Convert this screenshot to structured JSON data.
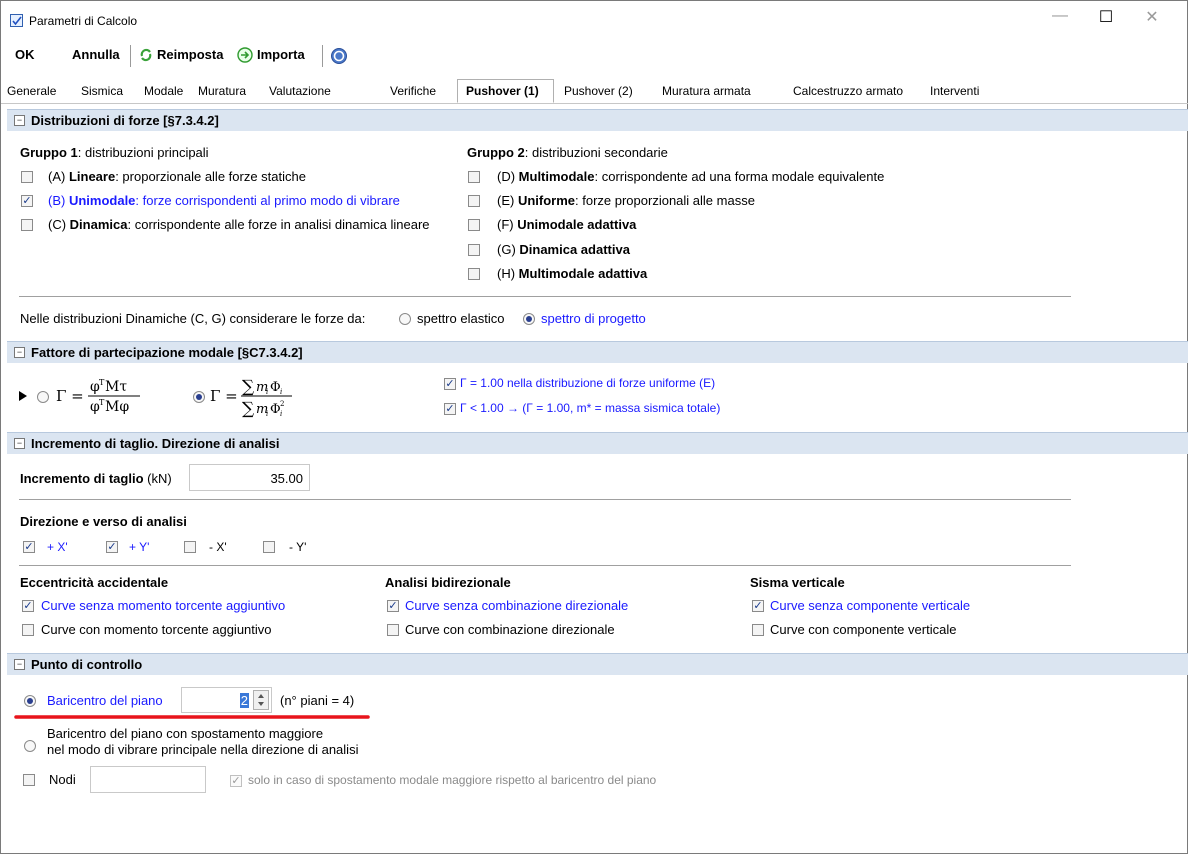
{
  "window": {
    "title": "Parametri di Calcolo",
    "minimize": "—",
    "maximize": "☐",
    "close": "✕"
  },
  "toolbar": {
    "ok": "OK",
    "annulla": "Annulla",
    "reimposta": "Reimposta",
    "importa": "Importa"
  },
  "tabs": [
    "Generale",
    "Sismica",
    "Modale",
    "Muratura",
    "Valutazione",
    "Verifiche",
    "Pushover (1)",
    "Pushover (2)",
    "Muratura armata",
    "Calcestruzzo armato",
    "Interventi"
  ],
  "active_tab": "Pushover (1)",
  "sec1": {
    "title": "Distribuzioni di forze [§7.3.4.2]",
    "g1_title_bold": "Gruppo 1",
    "g1_title_rest": ": distribuzioni principali",
    "g1": [
      {
        "prefix": "(A) ",
        "bold": "Lineare",
        "rest": ": proporzionale alle forze statiche",
        "checked": false
      },
      {
        "prefix": "(B) ",
        "bold": "Unimodale",
        "rest": ": forze corrispondenti al primo modo di vibrare",
        "checked": true
      },
      {
        "prefix": "(C) ",
        "bold": "Dinamica",
        "rest": ": corrispondente alle forze in analisi dinamica lineare",
        "checked": false
      }
    ],
    "g2_title_bold": "Gruppo 2",
    "g2_title_rest": ": distribuzioni secondarie",
    "g2": [
      {
        "prefix": "(D) ",
        "bold": "Multimodale",
        "rest": ": corrispondente ad una forma modale equivalente",
        "checked": false
      },
      {
        "prefix": "(E) ",
        "bold": "Uniforme",
        "rest": ": forze proporzionali alle masse",
        "checked": false
      },
      {
        "prefix": "(F) ",
        "bold": "Unimodale adattiva",
        "rest": "",
        "checked": false
      },
      {
        "prefix": "(G) ",
        "bold": "Dinamica adattiva",
        "rest": "",
        "checked": false
      },
      {
        "prefix": "(H) ",
        "bold": "Multimodale adattiva",
        "rest": "",
        "checked": false
      }
    ],
    "dyn_label": "Nelle distribuzioni Dinamiche (C, G) considerare le forze da:",
    "dyn_opt1": "spettro elastico",
    "dyn_opt2": "spettro di progetto"
  },
  "sec2": {
    "title": "Fattore di partecipazione modale [§C7.3.4.2]",
    "check1": "Γ = 1.00 nella distribuzione di forze uniforme (E)",
    "check2": "Γ < 1.00 → (Γ = 1.00, m* = massa sismica totale)"
  },
  "sec3": {
    "title": "Incremento di taglio. Direzione di analisi",
    "incr_label_bold": "Incremento di taglio",
    "incr_label_rest": " (kN)",
    "incr_value": "35.00",
    "dir_title": "Direzione e verso di analisi",
    "dirs": [
      {
        "label": "+ X'",
        "checked": true
      },
      {
        "label": "+ Y'",
        "checked": true
      },
      {
        "label": "- X'",
        "checked": false
      },
      {
        "label": "- Y'",
        "checked": false
      }
    ],
    "ecc_title": "Eccentricità accidentale",
    "ecc_opt1": "Curve senza momento torcente aggiuntivo",
    "ecc_opt2": "Curve con momento torcente aggiuntivo",
    "bid_title": "Analisi bidirezionale",
    "bid_opt1": "Curve senza combinazione direzionale",
    "bid_opt2": "Curve con combinazione direzionale",
    "sv_title": "Sisma verticale",
    "sv_opt1": "Curve senza componente verticale",
    "sv_opt2": "Curve con componente verticale"
  },
  "sec4": {
    "title": "Punto di controllo",
    "opt1": "Baricentro del piano",
    "piano_value": "2",
    "piani_note": "(n° piani = 4)",
    "opt2_line1": "Baricentro del piano con spostamento maggiore",
    "opt2_line2": "nel modo di vibrare principale nella direzione di analisi",
    "nodi_label": "Nodi",
    "nodi_value": "",
    "nodi_check": "solo in caso di spostamento modale maggiore rispetto al baricentro del piano"
  },
  "colors": {
    "section_bg": "#dbe5f1",
    "link_blue": "#1a1aff",
    "annotation_red": "#e8141c"
  }
}
